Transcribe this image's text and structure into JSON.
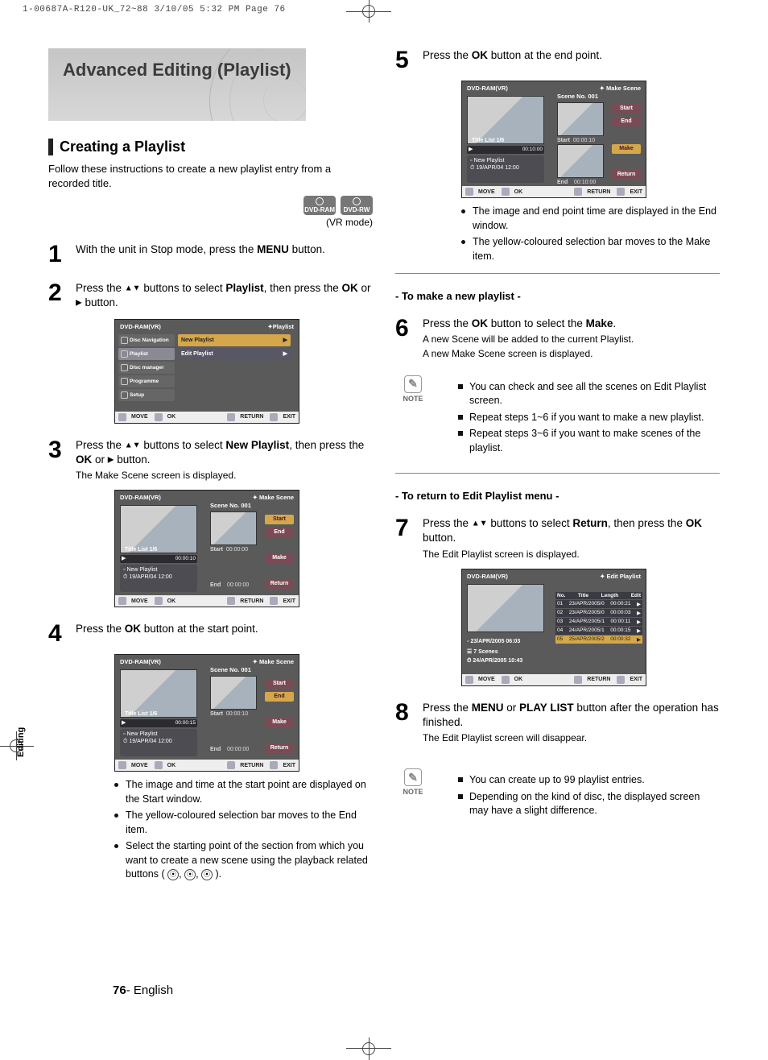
{
  "print_meta": "1-00687A-R120-UK_72~88  3/10/05  5:32 PM  Page 76",
  "title": "Advanced Editing (Playlist)",
  "subhead": "Creating a Playlist",
  "intro": "Follow these instructions to create a new playlist entry from a recorded title.",
  "media_badges": [
    "DVD-RAM",
    "DVD-RW"
  ],
  "vr_mode": "(VR mode)",
  "steps": {
    "s1": {
      "num": "1",
      "text_a": "With the unit in Stop mode, press the ",
      "b1": "MENU",
      "text_b": " button."
    },
    "s2": {
      "num": "2",
      "text_a": "Press the ",
      "tri": "▲▼",
      "text_b": " buttons to select ",
      "b1": "Playlist",
      "text_c": ", then press the ",
      "b2": "OK",
      "text_d": " or ",
      "tri2": "▶",
      "text_e": " button."
    },
    "s3": {
      "num": "3",
      "text_a": "Press the ",
      "tri": "▲▼",
      "text_b": " buttons to select ",
      "b1": "New Playlist",
      "text_c": ", then press the ",
      "b2": "OK",
      "text_d": " or ",
      "tri2": "▶",
      "text_e": " button.",
      "sub": "The Make Scene screen is displayed."
    },
    "s4": {
      "num": "4",
      "text_a": "Press the ",
      "b1": "OK",
      "text_b": " button at the start point."
    },
    "s5": {
      "num": "5",
      "text_a": "Press the ",
      "b1": "OK",
      "text_b": " button at the end point."
    },
    "s6": {
      "num": "6",
      "text_a": "Press the ",
      "b1": "OK",
      "text_b": " button to select the ",
      "b2": "Make",
      "text_c": ".",
      "sub1": "A new Scene will be added to the current Playlist.",
      "sub2": "A new Make Scene screen is displayed."
    },
    "s7": {
      "num": "7",
      "text_a": "Press the ",
      "tri": "▲▼",
      "text_b": " buttons to select ",
      "b1": "Return",
      "text_c": ", then press the ",
      "b2": "OK",
      "text_d": " button.",
      "sub": "The Edit Playlist screen is displayed."
    },
    "s8": {
      "num": "8",
      "text_a": "Press the ",
      "b1": "MENU",
      "text_b": " or ",
      "b2": "PLAY LIST",
      "text_c": " button after the operation has finished.",
      "sub": "The Edit Playlist screen will disappear."
    }
  },
  "screenshot_common": {
    "dvd_label": "DVD-RAM(VR)",
    "move": "MOVE",
    "ok": "OK",
    "return": "RETURN",
    "exit": "EXIT",
    "title_list": "Title List  1/6",
    "new_playlist_panel": "New Playlist",
    "date": "19/APR/04 12:00",
    "scene_no": "Scene No. 001",
    "btn_start": "Start",
    "btn_end": "End",
    "btn_make": "Make",
    "btn_return": "Return"
  },
  "ss2": {
    "top_right": "Playlist",
    "menu_left": [
      "Disc Navigation",
      "Playlist",
      "Disc manager",
      "Programme",
      "Setup"
    ],
    "menu_right": [
      "New Playlist",
      "Edit Playlist"
    ]
  },
  "ss3": {
    "top_right": "Make Scene",
    "start_time": "00:00:00",
    "end_time": "00:00:00",
    "prog_time": "00:00:10"
  },
  "ss4": {
    "top_right": "Make Scene",
    "start_time": "00:00:10",
    "end_time": "00:00:00",
    "prog_time": "00:00:15"
  },
  "ss5": {
    "top_right": "Make Scene",
    "start_time": "00:00:10",
    "end_time": "00:10:00",
    "prog_time": "00:10:00"
  },
  "ss7": {
    "top_right": "Edit Playlist",
    "info_date1": "23/APR/2005 06:03",
    "info_scenes": "7 Scenes",
    "info_date2": "24/APR/2005 10:43",
    "head_no": "No.",
    "head_title": "Title",
    "head_len": "Length",
    "head_edit": "Edit",
    "rows": [
      {
        "no": "01",
        "title": "23/APR/2005/0",
        "len": "00:00:21"
      },
      {
        "no": "02",
        "title": "23/APR/2005/0",
        "len": "00:00:03"
      },
      {
        "no": "03",
        "title": "24/APR/2005/1",
        "len": "00:00:11"
      },
      {
        "no": "04",
        "title": "24/APR/2005/1",
        "len": "00:00:15"
      },
      {
        "no": "05",
        "title": "25/APR/2005/2",
        "len": "00:00:32"
      }
    ]
  },
  "bullets_after4": [
    "The image and time at the start point are displayed on the Start window.",
    "The yellow-coloured selection bar moves to the End item.",
    "Select the starting point of the section from which you want to create a new scene using the playback related  buttons ("
  ],
  "playback_tail": ").",
  "bullets_after5": [
    "The image and end point time are displayed in the End window.",
    "The yellow-coloured selection bar moves to the Make  item."
  ],
  "sect_make": "- To make a new playlist -",
  "note1": [
    "You can check and see all the scenes on Edit Playlist screen.",
    "Repeat steps 1~6 if you want to make a new playlist.",
    "Repeat steps 3~6 if you want to make scenes of the playlist."
  ],
  "sect_return": "- To return to Edit Playlist menu -",
  "note2": [
    "You can create up to 99 playlist entries.",
    "Depending on the kind of disc, the displayed screen may have a slight difference."
  ],
  "note_label": "NOTE",
  "side_tab": "Editing",
  "page_num": "76",
  "page_lang": "- English"
}
